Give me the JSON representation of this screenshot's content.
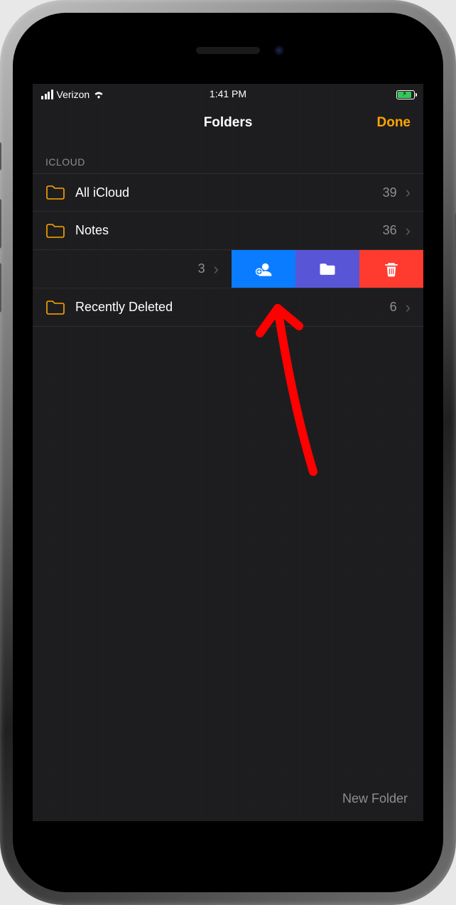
{
  "statusbar": {
    "carrier": "Verizon",
    "time": "1:41 PM"
  },
  "nav": {
    "title": "Folders",
    "done": "Done"
  },
  "section_header": "ICLOUD",
  "rows": {
    "all_icloud": {
      "label": "All iCloud",
      "count": "39"
    },
    "notes": {
      "label": "Notes",
      "count": "36"
    },
    "swiped": {
      "count": "3"
    },
    "recent": {
      "label": "Recently Deleted",
      "count": "6"
    }
  },
  "bottom": {
    "new_folder": "New Folder"
  },
  "colors": {
    "accent": "#ffa500",
    "share_action": "#0a7cff",
    "move_action": "#5856d6",
    "delete_action": "#ff3b30"
  },
  "swipe_actions": {
    "share_icon": "person-add-icon",
    "move_icon": "folder-icon",
    "delete_icon": "trash-icon"
  }
}
